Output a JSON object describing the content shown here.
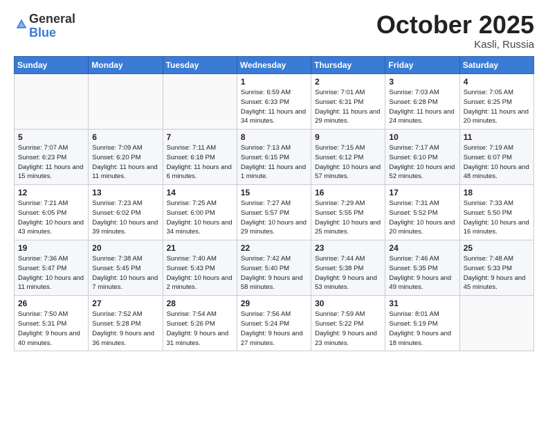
{
  "logo": {
    "general": "General",
    "blue": "Blue"
  },
  "title": "October 2025",
  "subtitle": "Kasli, Russia",
  "header_days": [
    "Sunday",
    "Monday",
    "Tuesday",
    "Wednesday",
    "Thursday",
    "Friday",
    "Saturday"
  ],
  "weeks": [
    [
      {
        "day": "",
        "info": ""
      },
      {
        "day": "",
        "info": ""
      },
      {
        "day": "",
        "info": ""
      },
      {
        "day": "1",
        "info": "Sunrise: 6:59 AM\nSunset: 6:33 PM\nDaylight: 11 hours\nand 34 minutes."
      },
      {
        "day": "2",
        "info": "Sunrise: 7:01 AM\nSunset: 6:31 PM\nDaylight: 11 hours\nand 29 minutes."
      },
      {
        "day": "3",
        "info": "Sunrise: 7:03 AM\nSunset: 6:28 PM\nDaylight: 11 hours\nand 24 minutes."
      },
      {
        "day": "4",
        "info": "Sunrise: 7:05 AM\nSunset: 6:25 PM\nDaylight: 11 hours\nand 20 minutes."
      }
    ],
    [
      {
        "day": "5",
        "info": "Sunrise: 7:07 AM\nSunset: 6:23 PM\nDaylight: 11 hours\nand 15 minutes."
      },
      {
        "day": "6",
        "info": "Sunrise: 7:09 AM\nSunset: 6:20 PM\nDaylight: 11 hours\nand 11 minutes."
      },
      {
        "day": "7",
        "info": "Sunrise: 7:11 AM\nSunset: 6:18 PM\nDaylight: 11 hours\nand 6 minutes."
      },
      {
        "day": "8",
        "info": "Sunrise: 7:13 AM\nSunset: 6:15 PM\nDaylight: 11 hours\nand 1 minute."
      },
      {
        "day": "9",
        "info": "Sunrise: 7:15 AM\nSunset: 6:12 PM\nDaylight: 10 hours\nand 57 minutes."
      },
      {
        "day": "10",
        "info": "Sunrise: 7:17 AM\nSunset: 6:10 PM\nDaylight: 10 hours\nand 52 minutes."
      },
      {
        "day": "11",
        "info": "Sunrise: 7:19 AM\nSunset: 6:07 PM\nDaylight: 10 hours\nand 48 minutes."
      }
    ],
    [
      {
        "day": "12",
        "info": "Sunrise: 7:21 AM\nSunset: 6:05 PM\nDaylight: 10 hours\nand 43 minutes."
      },
      {
        "day": "13",
        "info": "Sunrise: 7:23 AM\nSunset: 6:02 PM\nDaylight: 10 hours\nand 39 minutes."
      },
      {
        "day": "14",
        "info": "Sunrise: 7:25 AM\nSunset: 6:00 PM\nDaylight: 10 hours\nand 34 minutes."
      },
      {
        "day": "15",
        "info": "Sunrise: 7:27 AM\nSunset: 5:57 PM\nDaylight: 10 hours\nand 29 minutes."
      },
      {
        "day": "16",
        "info": "Sunrise: 7:29 AM\nSunset: 5:55 PM\nDaylight: 10 hours\nand 25 minutes."
      },
      {
        "day": "17",
        "info": "Sunrise: 7:31 AM\nSunset: 5:52 PM\nDaylight: 10 hours\nand 20 minutes."
      },
      {
        "day": "18",
        "info": "Sunrise: 7:33 AM\nSunset: 5:50 PM\nDaylight: 10 hours\nand 16 minutes."
      }
    ],
    [
      {
        "day": "19",
        "info": "Sunrise: 7:36 AM\nSunset: 5:47 PM\nDaylight: 10 hours\nand 11 minutes."
      },
      {
        "day": "20",
        "info": "Sunrise: 7:38 AM\nSunset: 5:45 PM\nDaylight: 10 hours\nand 7 minutes."
      },
      {
        "day": "21",
        "info": "Sunrise: 7:40 AM\nSunset: 5:43 PM\nDaylight: 10 hours\nand 2 minutes."
      },
      {
        "day": "22",
        "info": "Sunrise: 7:42 AM\nSunset: 5:40 PM\nDaylight: 9 hours\nand 58 minutes."
      },
      {
        "day": "23",
        "info": "Sunrise: 7:44 AM\nSunset: 5:38 PM\nDaylight: 9 hours\nand 53 minutes."
      },
      {
        "day": "24",
        "info": "Sunrise: 7:46 AM\nSunset: 5:35 PM\nDaylight: 9 hours\nand 49 minutes."
      },
      {
        "day": "25",
        "info": "Sunrise: 7:48 AM\nSunset: 5:33 PM\nDaylight: 9 hours\nand 45 minutes."
      }
    ],
    [
      {
        "day": "26",
        "info": "Sunrise: 7:50 AM\nSunset: 5:31 PM\nDaylight: 9 hours\nand 40 minutes."
      },
      {
        "day": "27",
        "info": "Sunrise: 7:52 AM\nSunset: 5:28 PM\nDaylight: 9 hours\nand 36 minutes."
      },
      {
        "day": "28",
        "info": "Sunrise: 7:54 AM\nSunset: 5:26 PM\nDaylight: 9 hours\nand 31 minutes."
      },
      {
        "day": "29",
        "info": "Sunrise: 7:56 AM\nSunset: 5:24 PM\nDaylight: 9 hours\nand 27 minutes."
      },
      {
        "day": "30",
        "info": "Sunrise: 7:59 AM\nSunset: 5:22 PM\nDaylight: 9 hours\nand 23 minutes."
      },
      {
        "day": "31",
        "info": "Sunrise: 8:01 AM\nSunset: 5:19 PM\nDaylight: 9 hours\nand 18 minutes."
      },
      {
        "day": "",
        "info": ""
      }
    ]
  ]
}
